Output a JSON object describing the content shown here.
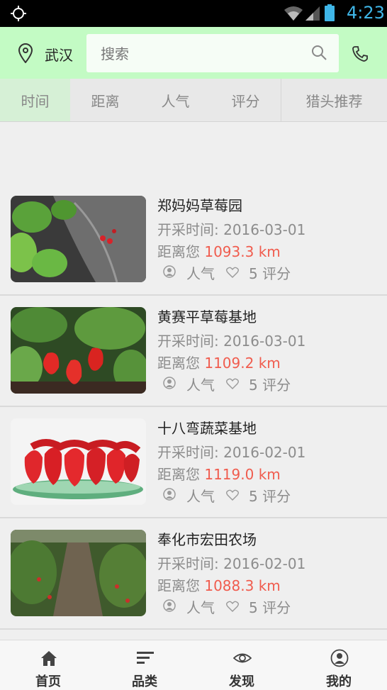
{
  "status_bar": {
    "time": "4:23"
  },
  "header": {
    "city": "武汉",
    "search_placeholder": "搜索"
  },
  "tabs": [
    {
      "label": "时间",
      "active": true
    },
    {
      "label": "距离"
    },
    {
      "label": "人气"
    },
    {
      "label": "评分"
    },
    {
      "label": "猎头推荐"
    }
  ],
  "items": [
    {
      "name": "郑妈妈草莓园",
      "date": "开采时间: 2016-03-01",
      "dist_prefix": "距离您",
      "distance": "1093.3 km",
      "popularity": "人气",
      "score": "5 评分"
    },
    {
      "name": "黄赛平草莓基地",
      "date": "开采时间: 2016-03-01",
      "dist_prefix": "距离您",
      "distance": "1109.2 km",
      "popularity": "人气",
      "score": "5 评分"
    },
    {
      "name": "十八弯蔬菜基地",
      "date": "开采时间: 2016-02-01",
      "dist_prefix": "距离您",
      "distance": "1119.0 km",
      "popularity": "人气",
      "score": "5 评分"
    },
    {
      "name": "奉化市宏田农场",
      "date": "开采时间: 2016-02-01",
      "dist_prefix": "距离您",
      "distance": "1088.3 km",
      "popularity": "人气",
      "score": "5 评分"
    }
  ],
  "bottom_nav": [
    {
      "label": "首页",
      "icon": "home-icon"
    },
    {
      "label": "品类",
      "icon": "category-icon"
    },
    {
      "label": "发现",
      "icon": "eye-icon"
    },
    {
      "label": "我的",
      "icon": "user-icon"
    }
  ],
  "colors": {
    "header_bg": "#c3fbc4",
    "distance_value": "#f05c4e",
    "active_tab_bg": "#d6f0d6",
    "time_color": "#3fb6e8"
  }
}
